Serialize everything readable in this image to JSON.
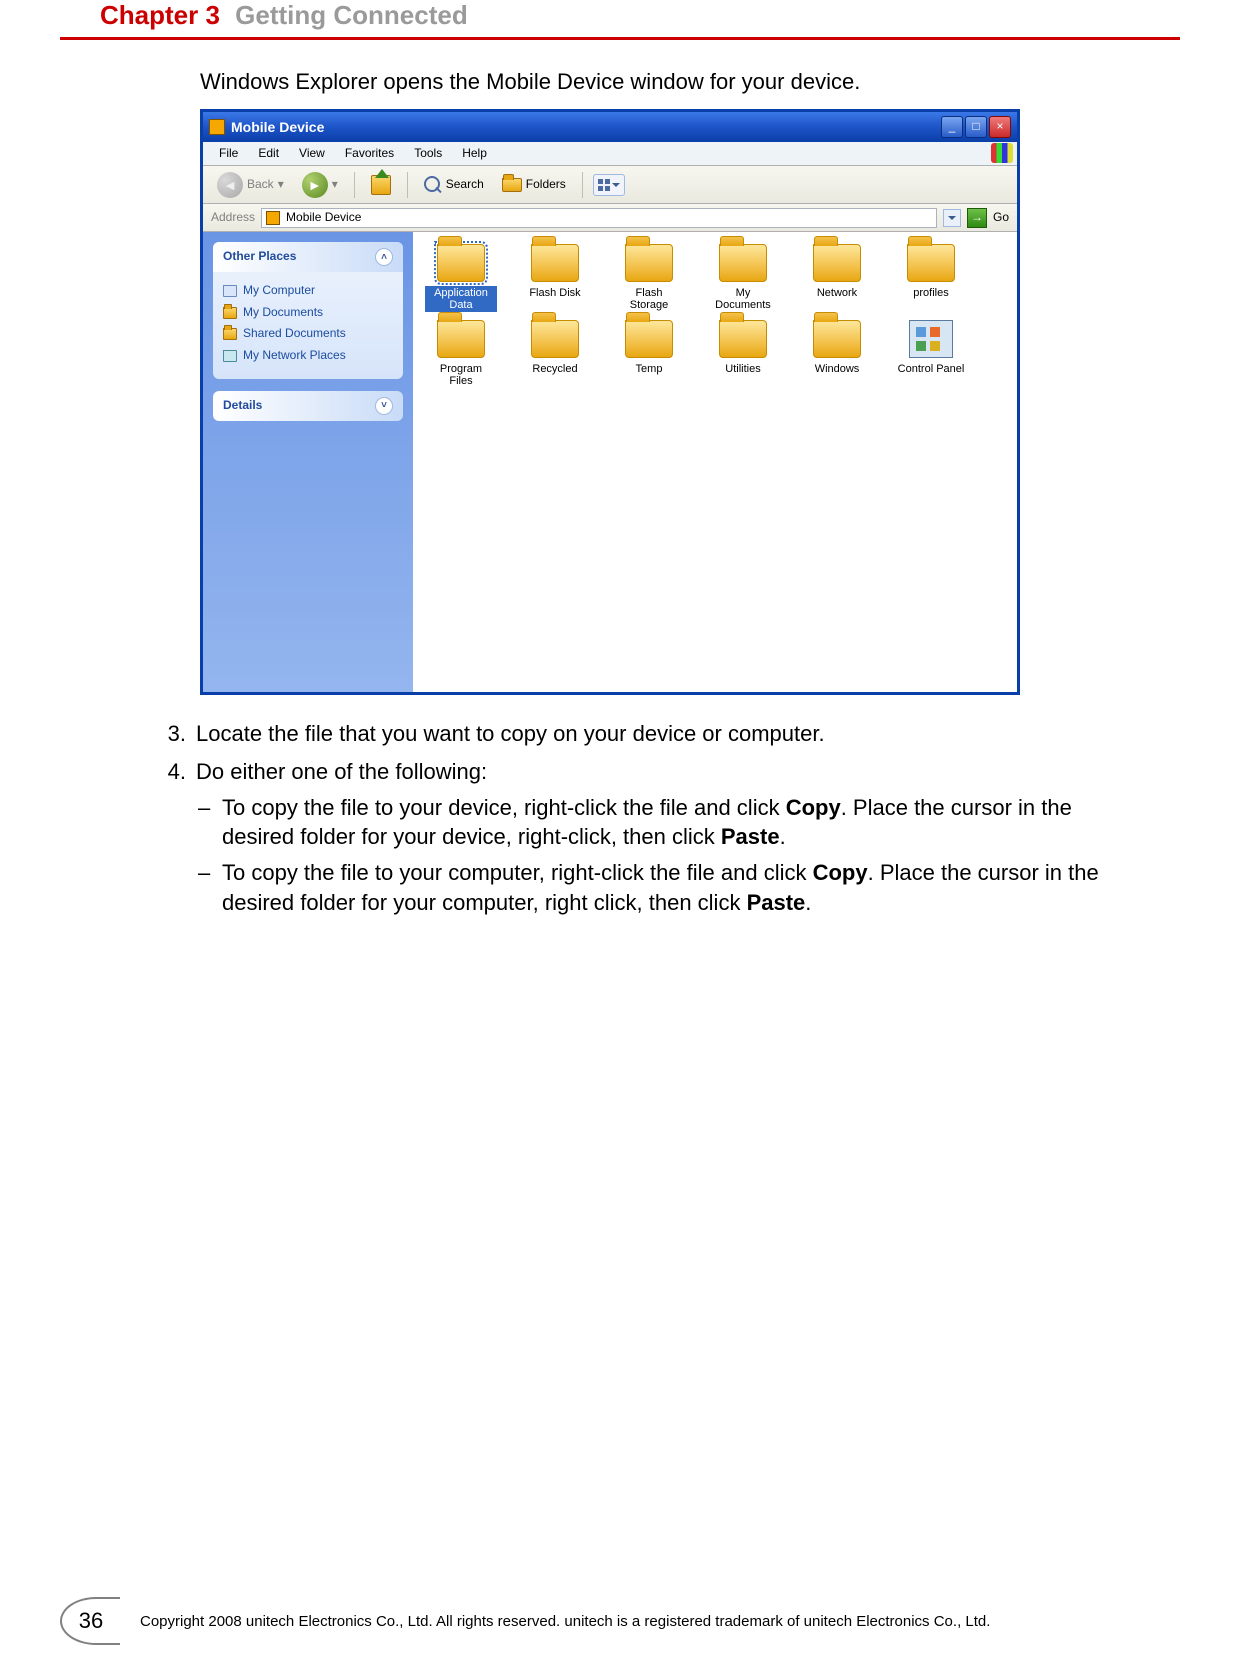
{
  "header": {
    "chapter_label": "Chapter 3",
    "chapter_title": "Getting Connected"
  },
  "intro": "Windows Explorer opens the Mobile Device window for your device.",
  "xp": {
    "title": "Mobile Device",
    "winbtn_min": "_",
    "winbtn_max": "□",
    "winbtn_close": "×",
    "menu": [
      "File",
      "Edit",
      "View",
      "Favorites",
      "Tools",
      "Help"
    ],
    "toolbar": {
      "back": "Back",
      "search": "Search",
      "folders": "Folders"
    },
    "address_label": "Address",
    "address_value": "Mobile Device",
    "go_label": "Go",
    "sidepane": {
      "other_places_title": "Other Places",
      "other_places": [
        "My Computer",
        "My Documents",
        "Shared Documents",
        "My Network Places"
      ],
      "details_title": "Details"
    },
    "items_row1": [
      "Application Data",
      "Flash Disk",
      "Flash Storage",
      "My Documents",
      "Network",
      "profiles",
      "Program Files"
    ],
    "items_row2": [
      "Recycled",
      "Temp",
      "Utilities",
      "Windows",
      "Control Panel"
    ]
  },
  "steps": {
    "s3_num": "3.",
    "s3_text": "Locate the file that you want to copy on your device or computer.",
    "s4_num": "4.",
    "s4_text": "Do either one of the following:",
    "dash": "–",
    "s4a_before": "To copy the file to your device, right-click the file and click ",
    "s4a_b1": "Copy",
    "s4a_mid": ". Place the cursor in the desired folder for your device, right-click, then click ",
    "s4a_b2": "Paste",
    "s4a_after": ".",
    "s4b_before": "To copy the file to your computer, right-click the file and click ",
    "s4b_b1": "Copy",
    "s4b_mid": ". Place the cursor in the desired folder for your computer, right click, then click ",
    "s4b_b2": "Paste",
    "s4b_after": "."
  },
  "footer": {
    "page_number": "36",
    "copyright": "Copyright 2008 unitech Electronics Co., Ltd. All rights reserved. unitech is a registered trademark of unitech Electronics Co., Ltd."
  }
}
